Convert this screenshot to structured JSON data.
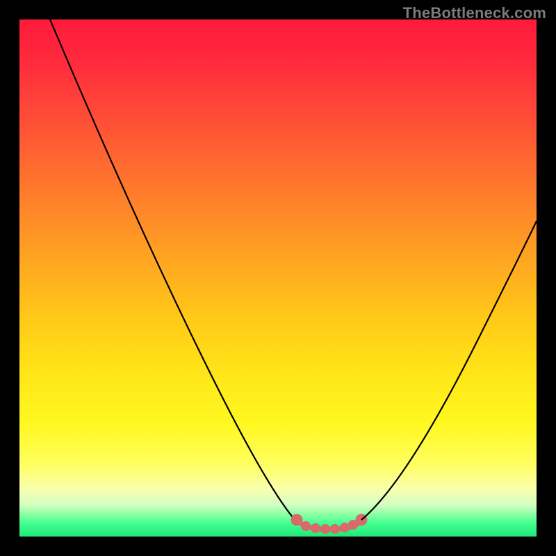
{
  "watermark": "TheBottleneck.com",
  "chart_data": {
    "type": "line",
    "title": "",
    "xlabel": "",
    "ylabel": "",
    "xlim": [
      0,
      100
    ],
    "ylim": [
      0,
      100
    ],
    "grid": false,
    "legend": false,
    "series": [
      {
        "name": "left-curve",
        "color": "#000000",
        "x": [
          6,
          14,
          22,
          30,
          38,
          44,
          50,
          53.5
        ],
        "values": [
          100,
          82,
          63,
          45,
          28,
          14,
          4,
          1.5
        ]
      },
      {
        "name": "flat-bottom",
        "color": "#d86a6a",
        "x": [
          53.5,
          55,
          58,
          61,
          64,
          66
        ],
        "values": [
          1.5,
          1.2,
          1.0,
          1.0,
          1.2,
          1.6
        ]
      },
      {
        "name": "right-curve",
        "color": "#000000",
        "x": [
          66,
          72,
          78,
          84,
          90,
          96,
          100
        ],
        "values": [
          1.6,
          6,
          14,
          25,
          38,
          52,
          62
        ]
      }
    ],
    "annotations": []
  }
}
